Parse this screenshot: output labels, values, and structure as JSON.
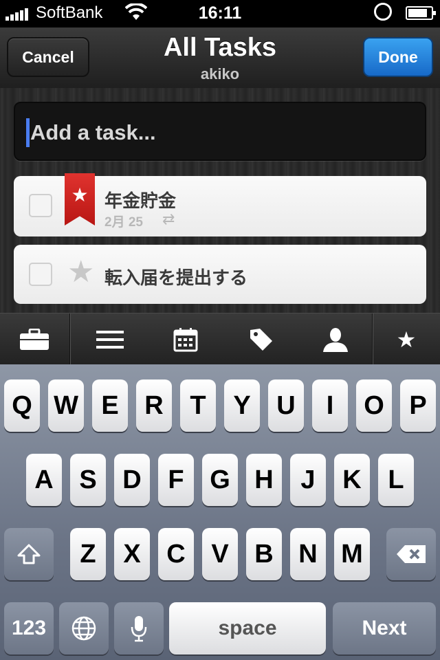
{
  "status_bar": {
    "carrier": "SoftBank",
    "time": "16:11",
    "battery_fraction": 0.85
  },
  "nav": {
    "cancel_label": "Cancel",
    "title": "All Tasks",
    "subtitle": "akiko",
    "done_label": "Done"
  },
  "add_task": {
    "placeholder": "Add a task..."
  },
  "tasks": [
    {
      "title": "年金貯金",
      "due": "2月 25",
      "starred": true,
      "repeats": true
    },
    {
      "title": "転入届を提出する",
      "starred": false
    }
  ],
  "toolbar": {
    "icons": [
      "briefcase-icon",
      "list-icon",
      "calendar-icon",
      "tag-icon",
      "person-icon",
      "star-icon"
    ]
  },
  "keyboard": {
    "row1": [
      "Q",
      "W",
      "E",
      "R",
      "T",
      "Y",
      "U",
      "I",
      "O",
      "P"
    ],
    "row2": [
      "A",
      "S",
      "D",
      "F",
      "G",
      "H",
      "J",
      "K",
      "L"
    ],
    "row3": [
      "Z",
      "X",
      "C",
      "V",
      "B",
      "N",
      "M"
    ],
    "numbers_label": "123",
    "space_label": "space",
    "next_label": "Next"
  }
}
